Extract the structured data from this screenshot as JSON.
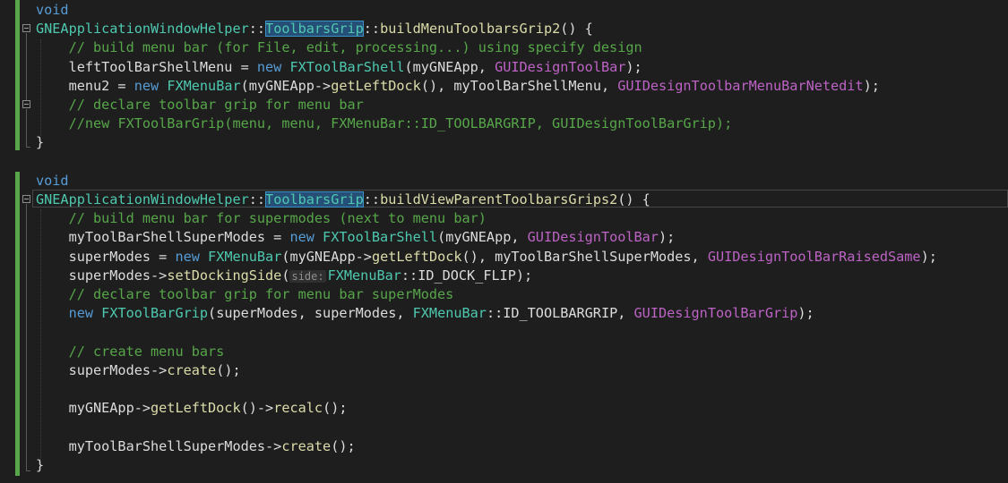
{
  "colors": {
    "background": "#1e1e1e",
    "keyword": "#569cd6",
    "type": "#4ec9b0",
    "function": "#dcdcaa",
    "macro": "#bd63c5",
    "comment": "#57a64a",
    "plain": "#dcdcdc",
    "change_bar": "#57a64a",
    "highlight": "#264f78"
  },
  "inlay_hint": "side:",
  "lines": [
    [
      [
        "kw",
        "void"
      ]
    ],
    [
      [
        "cls",
        "GNEApplicationWindowHelper"
      ],
      [
        "pl",
        "::"
      ],
      [
        "hl",
        "ToolbarsGrip"
      ],
      [
        "pl",
        "::"
      ],
      [
        "fn",
        "buildMenuToolbarsGrip2"
      ],
      [
        "pl",
        "() {"
      ]
    ],
    [
      [
        "pl",
        "    "
      ],
      [
        "cm",
        "// build menu bar (for File, edit, processing...) using specify design"
      ]
    ],
    [
      [
        "pl",
        "    leftToolBarShellMenu = "
      ],
      [
        "kw",
        "new"
      ],
      [
        "pl",
        " "
      ],
      [
        "cls",
        "FXToolBarShell"
      ],
      [
        "pl",
        "(myGNEApp, "
      ],
      [
        "mac",
        "GUIDesignToolBar"
      ],
      [
        "pl",
        ");"
      ]
    ],
    [
      [
        "pl",
        "    menu2 = "
      ],
      [
        "kw",
        "new"
      ],
      [
        "pl",
        " "
      ],
      [
        "cls",
        "FXMenuBar"
      ],
      [
        "pl",
        "(myGNEApp->"
      ],
      [
        "fn",
        "getLeftDock"
      ],
      [
        "pl",
        "(), myToolBarShellMenu, "
      ],
      [
        "mac",
        "GUIDesignToolbarMenuBarNetedit"
      ],
      [
        "pl",
        ");"
      ]
    ],
    [
      [
        "pl",
        "    "
      ],
      [
        "cm",
        "// declare toolbar grip for menu bar"
      ]
    ],
    [
      [
        "pl",
        "    "
      ],
      [
        "cm",
        "//new FXToolBarGrip(menu, menu, FXMenuBar::ID_TOOLBARGRIP, GUIDesignToolBarGrip);"
      ]
    ],
    [
      [
        "pl",
        "}"
      ]
    ],
    [
      [
        "pl",
        ""
      ]
    ],
    [
      [
        "kw",
        "void"
      ]
    ],
    [
      [
        "cls",
        "GNEApplicationWindowHelper"
      ],
      [
        "pl",
        "::"
      ],
      [
        "hl",
        "ToolbarsGrip"
      ],
      [
        "pl",
        "::"
      ],
      [
        "fn",
        "buildViewParentToolbarsGrips2"
      ],
      [
        "pl",
        "() {"
      ]
    ],
    [
      [
        "pl",
        "    "
      ],
      [
        "cm",
        "// build menu bar for supermodes (next to menu bar)"
      ]
    ],
    [
      [
        "pl",
        "    myToolBarShellSuperModes = "
      ],
      [
        "kw",
        "new"
      ],
      [
        "pl",
        " "
      ],
      [
        "cls",
        "FXToolBarShell"
      ],
      [
        "pl",
        "(myGNEApp, "
      ],
      [
        "mac",
        "GUIDesignToolBar"
      ],
      [
        "pl",
        ");"
      ]
    ],
    [
      [
        "pl",
        "    superModes = "
      ],
      [
        "kw",
        "new"
      ],
      [
        "pl",
        " "
      ],
      [
        "cls",
        "FXMenuBar"
      ],
      [
        "pl",
        "(myGNEApp->"
      ],
      [
        "fn",
        "getLeftDock"
      ],
      [
        "pl",
        "(), myToolBarShellSuperModes, "
      ],
      [
        "mac",
        "GUIDesignToolBarRaisedSame"
      ],
      [
        "pl",
        ");"
      ]
    ],
    [
      [
        "pl",
        "    superModes->"
      ],
      [
        "fn",
        "setDockingSide"
      ],
      [
        "pl",
        "("
      ],
      [
        "hint",
        "side:"
      ],
      [
        "cls",
        "FXMenuBar"
      ],
      [
        "pl",
        "::ID_DOCK_FLIP);"
      ]
    ],
    [
      [
        "pl",
        "    "
      ],
      [
        "cm",
        "// declare toolbar grip for menu bar superModes"
      ]
    ],
    [
      [
        "pl",
        "    "
      ],
      [
        "kw",
        "new"
      ],
      [
        "pl",
        " "
      ],
      [
        "cls",
        "FXToolBarGrip"
      ],
      [
        "pl",
        "(superModes, superModes, "
      ],
      [
        "cls",
        "FXMenuBar"
      ],
      [
        "pl",
        "::ID_TOOLBARGRIP, "
      ],
      [
        "mac",
        "GUIDesignToolBarGrip"
      ],
      [
        "pl",
        ");"
      ]
    ],
    [
      [
        "pl",
        ""
      ]
    ],
    [
      [
        "pl",
        "    "
      ],
      [
        "cm",
        "// create menu bars"
      ]
    ],
    [
      [
        "pl",
        "    superModes->"
      ],
      [
        "fn",
        "create"
      ],
      [
        "pl",
        "();"
      ]
    ],
    [
      [
        "pl",
        ""
      ]
    ],
    [
      [
        "pl",
        "    myGNEApp->"
      ],
      [
        "fn",
        "getLeftDock"
      ],
      [
        "pl",
        "()->"
      ],
      [
        "fn",
        "recalc"
      ],
      [
        "pl",
        "();"
      ]
    ],
    [
      [
        "pl",
        ""
      ]
    ],
    [
      [
        "pl",
        "    myToolBarShellSuperModes->"
      ],
      [
        "fn",
        "create"
      ],
      [
        "pl",
        "();"
      ]
    ],
    [
      [
        "pl",
        "}"
      ]
    ]
  ]
}
